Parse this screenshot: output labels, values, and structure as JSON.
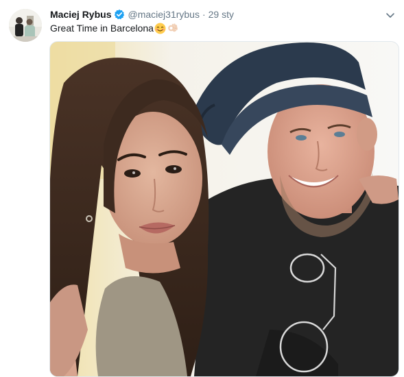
{
  "tweet": {
    "display_name": "Maciej Rybus",
    "handle": "@maciej31rybus",
    "separator": "·",
    "date": "29 sty",
    "text": "Great Time in Barcelona",
    "emojis": [
      "smiling-face-with-smiling-eyes",
      "ok-hand-light-skin-tone"
    ],
    "verified": true
  },
  "icons": {
    "verified": "verified-badge-icon",
    "menu": "chevron-down-icon"
  },
  "colors": {
    "name": "#14171a",
    "secondary": "#657786",
    "verified_blue": "#1da1f2",
    "border": "#e1e8ed"
  }
}
